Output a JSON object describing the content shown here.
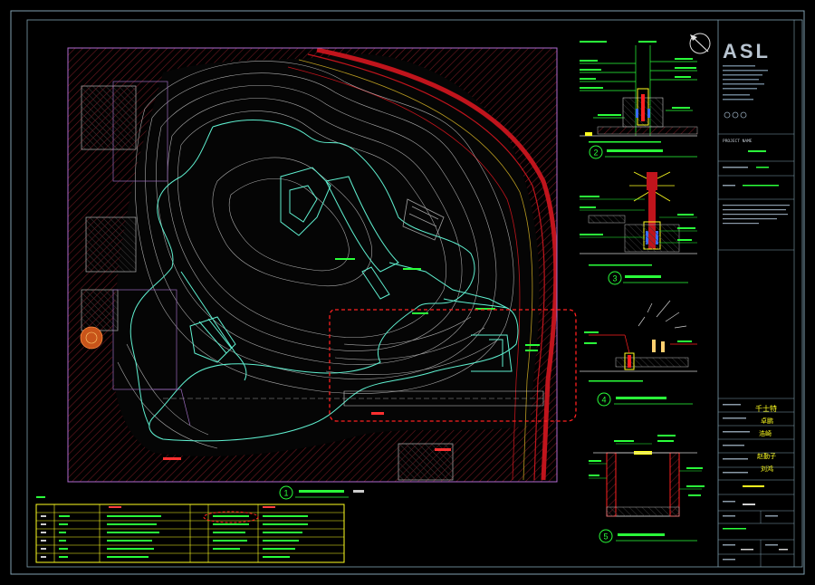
{
  "firm": {
    "logo": "ASL"
  },
  "title_block": {
    "project_name_label": "PROJECT NAME",
    "sign_1": "千士特",
    "sign_2": "卓鹏",
    "sign_3": "浩崎",
    "sign_4": "赵勤子",
    "sign_5": "刘鸿"
  },
  "details": [
    {
      "number": "1"
    },
    {
      "number": "2"
    },
    {
      "number": "3"
    },
    {
      "number": "4"
    },
    {
      "number": "5"
    }
  ],
  "colors": {
    "background": "#000000",
    "border": "#7f9fb0",
    "plan_frame": "#b06ad0",
    "path_outline": "#5ff0d0",
    "contour": "#c8c8c8",
    "red_road": "#c0141c",
    "hatch": "#7a1a22",
    "detail_green": "#2aff3a",
    "detail_yellow": "#ffff20",
    "highlight": "#ff2020",
    "table": "#ffff20"
  }
}
